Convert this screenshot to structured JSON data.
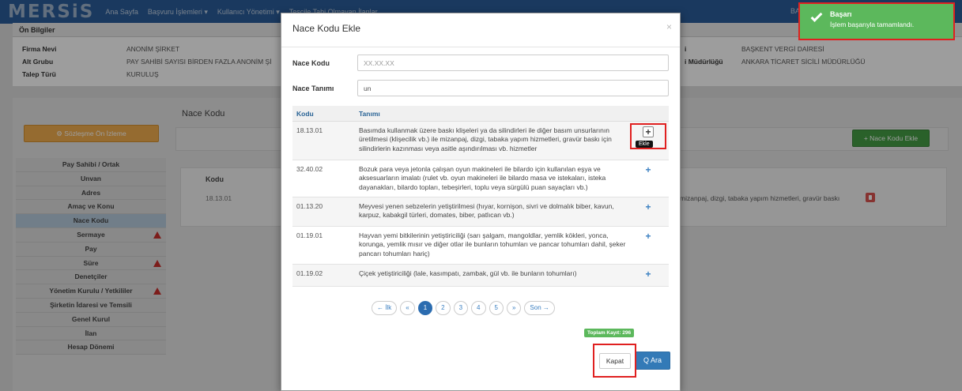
{
  "nav": {
    "logo": "MERSiS",
    "items": [
      "Ana Sayfa",
      "Başvuru İşlemleri ▾",
      "Kullanıcı Yönetimi ▾",
      "Tescile Tabi Olmayan İlanlar"
    ],
    "user": "BA"
  },
  "info": {
    "header": "Ön Bilgiler",
    "firma_nevi_label": "Firma Nevi",
    "firma_nevi_value": "ANONİM ŞİRKET",
    "alt_grubu_label": "Alt Grubu",
    "alt_grubu_value": "PAY SAHİBİ SAYISI BİRDEN FAZLA ANONİM Şİ",
    "talep_turu_label": "Talep Türü",
    "talep_turu_value": "KURULUŞ",
    "vergi_label": "i",
    "vergi_value": "BAŞKENT VERGİ DAİRESİ",
    "sicil_label": "i Müdürlüğü",
    "sicil_value": "ANKARA TİCARET SİCİLİ MÜDÜRLÜĞÜ"
  },
  "preview_button": "⚙ Sözleşme Ön İzleme",
  "side_menu": [
    {
      "label": "Pay Sahibi / Ortak",
      "warn": false,
      "active": false
    },
    {
      "label": "Unvan",
      "warn": false,
      "active": false
    },
    {
      "label": "Adres",
      "warn": false,
      "active": false
    },
    {
      "label": "Amaç ve Konu",
      "warn": false,
      "active": false
    },
    {
      "label": "Nace Kodu",
      "warn": false,
      "active": true
    },
    {
      "label": "Sermaye",
      "warn": true,
      "active": false
    },
    {
      "label": "Pay",
      "warn": false,
      "active": false
    },
    {
      "label": "Süre",
      "warn": true,
      "active": false
    },
    {
      "label": "Denetçiler",
      "warn": false,
      "active": false
    },
    {
      "label": "Yönetim Kurulu / Yetkililer",
      "warn": true,
      "active": false
    },
    {
      "label": "Şirketin İdaresi ve Temsili",
      "warn": false,
      "active": false
    },
    {
      "label": "Genel Kurul",
      "warn": false,
      "active": false
    },
    {
      "label": "İlan",
      "warn": false,
      "active": false
    },
    {
      "label": "Hesap Dönemi",
      "warn": false,
      "active": false
    }
  ],
  "background": {
    "section_title": "Nace Kodu",
    "add_button": "+ Nace Kodu Ekle",
    "table_header": "Kodu",
    "row_code": "18.13.01",
    "row_text": "mizanpaj, dizgi, tabaka yapım hizmetleri, gravür baskı"
  },
  "modal": {
    "title": "Nace Kodu Ekle",
    "close": "×",
    "nace_kodu_label": "Nace Kodu",
    "nace_kodu_placeholder": "XX.XX.XX",
    "nace_tanimi_label": "Nace Tanımı",
    "nace_tanimi_value": "un",
    "col_kodu": "Kodu",
    "col_tanimi": "Tanımı",
    "rows": [
      {
        "code": "18.13.01",
        "desc": "Basımda kullanmak üzere baskı klişeleri ya da silindirleri ile diğer basım unsurlarının üretilmesi (klişecilik vb.) ile mizanpaj, dizgi, tabaka yapım hizmetleri, gravür baskı için silindirlerin kazınması veya asitle aşındırılması vb. hizmetler"
      },
      {
        "code": "32.40.02",
        "desc": "Bozuk para veya jetonla çalışan oyun makineleri ile bilardo için kullanılan eşya ve aksesuarların imalatı (rulet vb. oyun makineleri ile bilardo masa ve istekaları, isteka dayanakları, bilardo topları, tebeşirleri, toplu veya sürgülü puan sayaçları vb.)"
      },
      {
        "code": "01.13.20",
        "desc": "Meyvesi yenen sebzelerin yetiştirilmesi (hıyar, kornişon, sivri ve dolmalık biber, kavun, karpuz, kabakgil türleri, domates, biber, patlıcan vb.)"
      },
      {
        "code": "01.19.01",
        "desc": "Hayvan yemi bitkilerinin yetiştiriciliği (sarı şalgam, mangoldlar, yemlik kökleri, yonca, korunga, yemlik mısır ve diğer otlar ile bunların tohumları ve pancar tohumları dahil, şeker pancarı tohumları hariç)"
      },
      {
        "code": "01.19.02",
        "desc": "Çiçek yetiştiriciliği (lale, kasımpatı, zambak, gül vb. ile bunların tohumları)"
      }
    ],
    "add_icon": "+",
    "tooltip": "Ekle",
    "pager": [
      "← İlk",
      "«",
      "1",
      "2",
      "3",
      "4",
      "5",
      "»",
      "Son →"
    ],
    "total": "Toplam Kayıt: 296",
    "kapat": "Kapat",
    "ara": "Q Ara"
  },
  "toast": {
    "title": "Başarı",
    "message": "İşlem başarıyla tamamlandı."
  }
}
